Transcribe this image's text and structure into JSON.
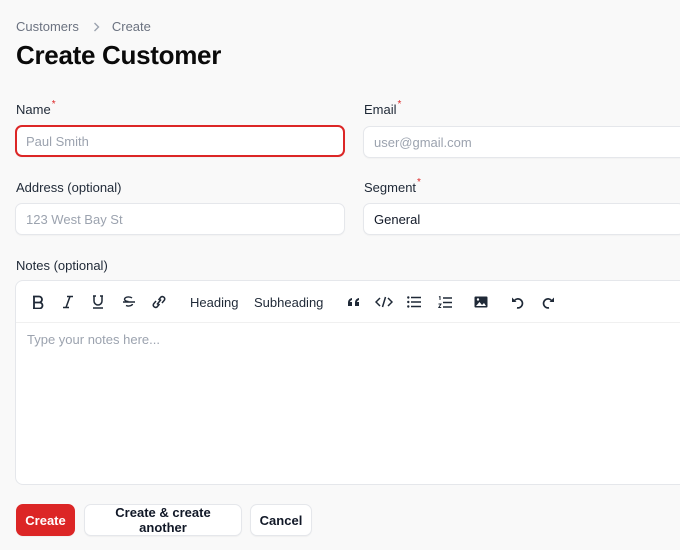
{
  "breadcrumb": {
    "items": [
      "Customers",
      "Create"
    ],
    "separator_icon": "chevron-right-icon"
  },
  "page": {
    "title": "Create Customer"
  },
  "form": {
    "name": {
      "label": "Name",
      "required": "*",
      "placeholder": "Paul Smith",
      "value": "",
      "state": "error"
    },
    "email": {
      "label": "Email",
      "required": "*",
      "placeholder": "user@gmail.com",
      "value": ""
    },
    "address": {
      "label": "Address (optional)",
      "placeholder": "123 West Bay St",
      "value": ""
    },
    "segment": {
      "label": "Segment",
      "required": "*",
      "value": "General",
      "icon": "chevron-down-icon"
    },
    "notes": {
      "label": "Notes (optional)",
      "placeholder": "Type your notes here...",
      "toolbar": {
        "bold": "B",
        "italic": "I",
        "underline": "U",
        "strike": "S",
        "heading": "Heading",
        "subheading": "Subheading"
      }
    }
  },
  "actions": {
    "create": "Create",
    "create_another": "Create & create another",
    "cancel": "Cancel"
  },
  "colors": {
    "accent": "#dc2626",
    "error_border": "#dc2626",
    "placeholder": "#9ca3af"
  }
}
